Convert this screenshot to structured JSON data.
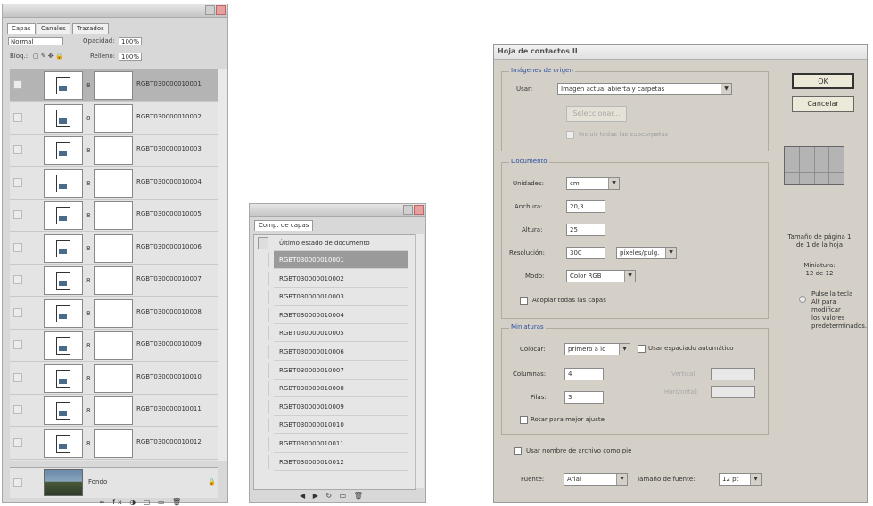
{
  "layers_panel": {
    "tabs": [
      "Capas",
      "Canales",
      "Trazados"
    ],
    "blend_mode": "Normal",
    "opacity_label": "Opacidad:",
    "opacity_value": "100%",
    "lock_label": "Bloq.:",
    "fill_label": "Relleno:",
    "fill_value": "100%",
    "layers": [
      {
        "name": "RGBT030000010001"
      },
      {
        "name": "RGBT030000010002"
      },
      {
        "name": "RGBT030000010003"
      },
      {
        "name": "RGBT030000010004"
      },
      {
        "name": "RGBT030000010005"
      },
      {
        "name": "RGBT030000010006"
      },
      {
        "name": "RGBT030000010007"
      },
      {
        "name": "RGBT030000010008"
      },
      {
        "name": "RGBT030000010009"
      },
      {
        "name": "RGBT030000010010"
      },
      {
        "name": "RGBT030000010011"
      },
      {
        "name": "RGBT030000010012"
      }
    ],
    "background_layer": "Fondo",
    "footer_icons": "∞ fx ◑ ▢ ▭ 🗑"
  },
  "comps_panel": {
    "tab": "Comp. de capas",
    "first_item": "Último estado de documento",
    "items": [
      "RGBT030000010001",
      "RGBT030000010002",
      "RGBT030000010003",
      "RGBT030000010004",
      "RGBT030000010005",
      "RGBT030000010006",
      "RGBT030000010007",
      "RGBT030000010008",
      "RGBT030000010009",
      "RGBT030000010010",
      "RGBT030000010011",
      "RGBT030000010012"
    ],
    "footer_icons": "◀ ▶ ↻ ▭ 🗑"
  },
  "dialog": {
    "title": "Hoja de contactos II",
    "source_group": {
      "title": "Imágenes de origen",
      "use_label": "Usar:",
      "use_value": "Imagen actual abierta y carpetas",
      "choose_button": "Seleccionar...",
      "include_subfolders": "Incluir todas las subcarpetas"
    },
    "document_group": {
      "title": "Documento",
      "units_label": "Unidades:",
      "units_value": "cm",
      "width_label": "Anchura:",
      "width_value": "20,3",
      "height_label": "Altura:",
      "height_value": "25",
      "resolution_label": "Resolución:",
      "resolution_value": "300",
      "resolution_unit": "píxeles/pulg.",
      "mode_label": "Modo:",
      "mode_value": "Color RGB",
      "flatten_label": "Acoplar todas las capas"
    },
    "thumbs_group": {
      "title": "Miniaturas",
      "place_label": "Colocar:",
      "place_value": "primero a lo",
      "auto_spacing": "Usar espaciado automático",
      "columns_label": "Columnas:",
      "columns_value": "4",
      "rows_label": "Filas:",
      "rows_value": "3",
      "rotate_label": "Rotar para mejor ajuste",
      "vertical_label": "Vertical:",
      "horizontal_label": "Horizontal:"
    },
    "filename_caption": "Usar nombre de archivo como pie",
    "font_label": "Fuente:",
    "font_value": "Arial",
    "font_size_label": "Tamaño de fuente:",
    "font_size_value": "12 pt",
    "ok_button": "OK",
    "cancel_button": "Cancelar",
    "page_info": "Tamaño de página 1\nde 1 de la hoja",
    "count_info": "Miniatura:\n12 de 12",
    "note_text": "Pulse la tecla\nAlt para\nmodificar\nlos valores\npredeterminados."
  }
}
